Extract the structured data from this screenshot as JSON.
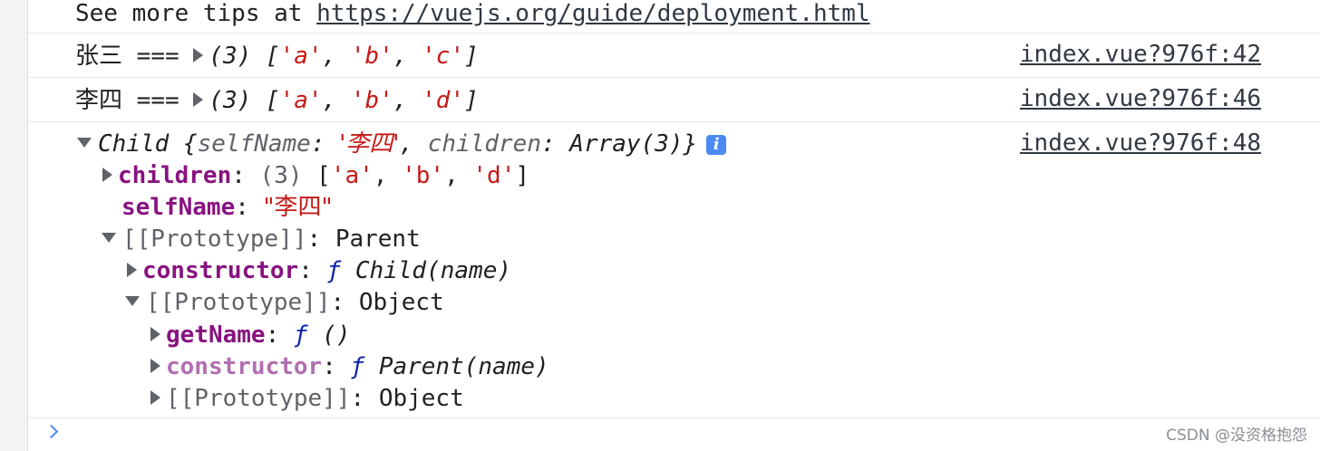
{
  "tip": {
    "prefix": "See more tips at ",
    "url": "https://vuejs.org/guide/deployment.html"
  },
  "log1": {
    "label": "张三",
    "op": "===",
    "count": "(3)",
    "items": [
      "'a'",
      "'b'",
      "'c'"
    ],
    "source": "index.vue?976f:42"
  },
  "log2": {
    "label": "李四",
    "op": "===",
    "count": "(3)",
    "items": [
      "'a'",
      "'b'",
      "'d'"
    ],
    "source": "index.vue?976f:46"
  },
  "log3": {
    "source": "index.vue?976f:48",
    "summary": {
      "class_name": "Child",
      "key1": "selfName",
      "val1": "'李四'",
      "key2": "children",
      "val2": "Array(3)"
    },
    "info_icon": "info-icon",
    "tree": {
      "children_key": "children",
      "children_count": "(3)",
      "children_items": [
        "'a'",
        "'b'",
        "'d'"
      ],
      "selfname_key": "selfName",
      "selfname_value": "\"李四\"",
      "proto1_key": "[[Prototype]]",
      "proto1_value": "Parent",
      "ctor1_key": "constructor",
      "ctor1_f": "ƒ",
      "ctor1_value": "Child(name)",
      "proto2_key": "[[Prototype]]",
      "proto2_value": "Object",
      "getname_key": "getName",
      "getname_f": "ƒ",
      "getname_value": "()",
      "ctor2_key": "constructor",
      "ctor2_f": "ƒ",
      "ctor2_value": "Parent(name)",
      "proto3_key": "[[Prototype]]",
      "proto3_value": "Object"
    }
  },
  "watermark": "CSDN @没资格抱怨",
  "colors": {
    "string": "#c41a16",
    "property": "#881280",
    "function": "#0d22aa",
    "info": "#4a8af4"
  }
}
